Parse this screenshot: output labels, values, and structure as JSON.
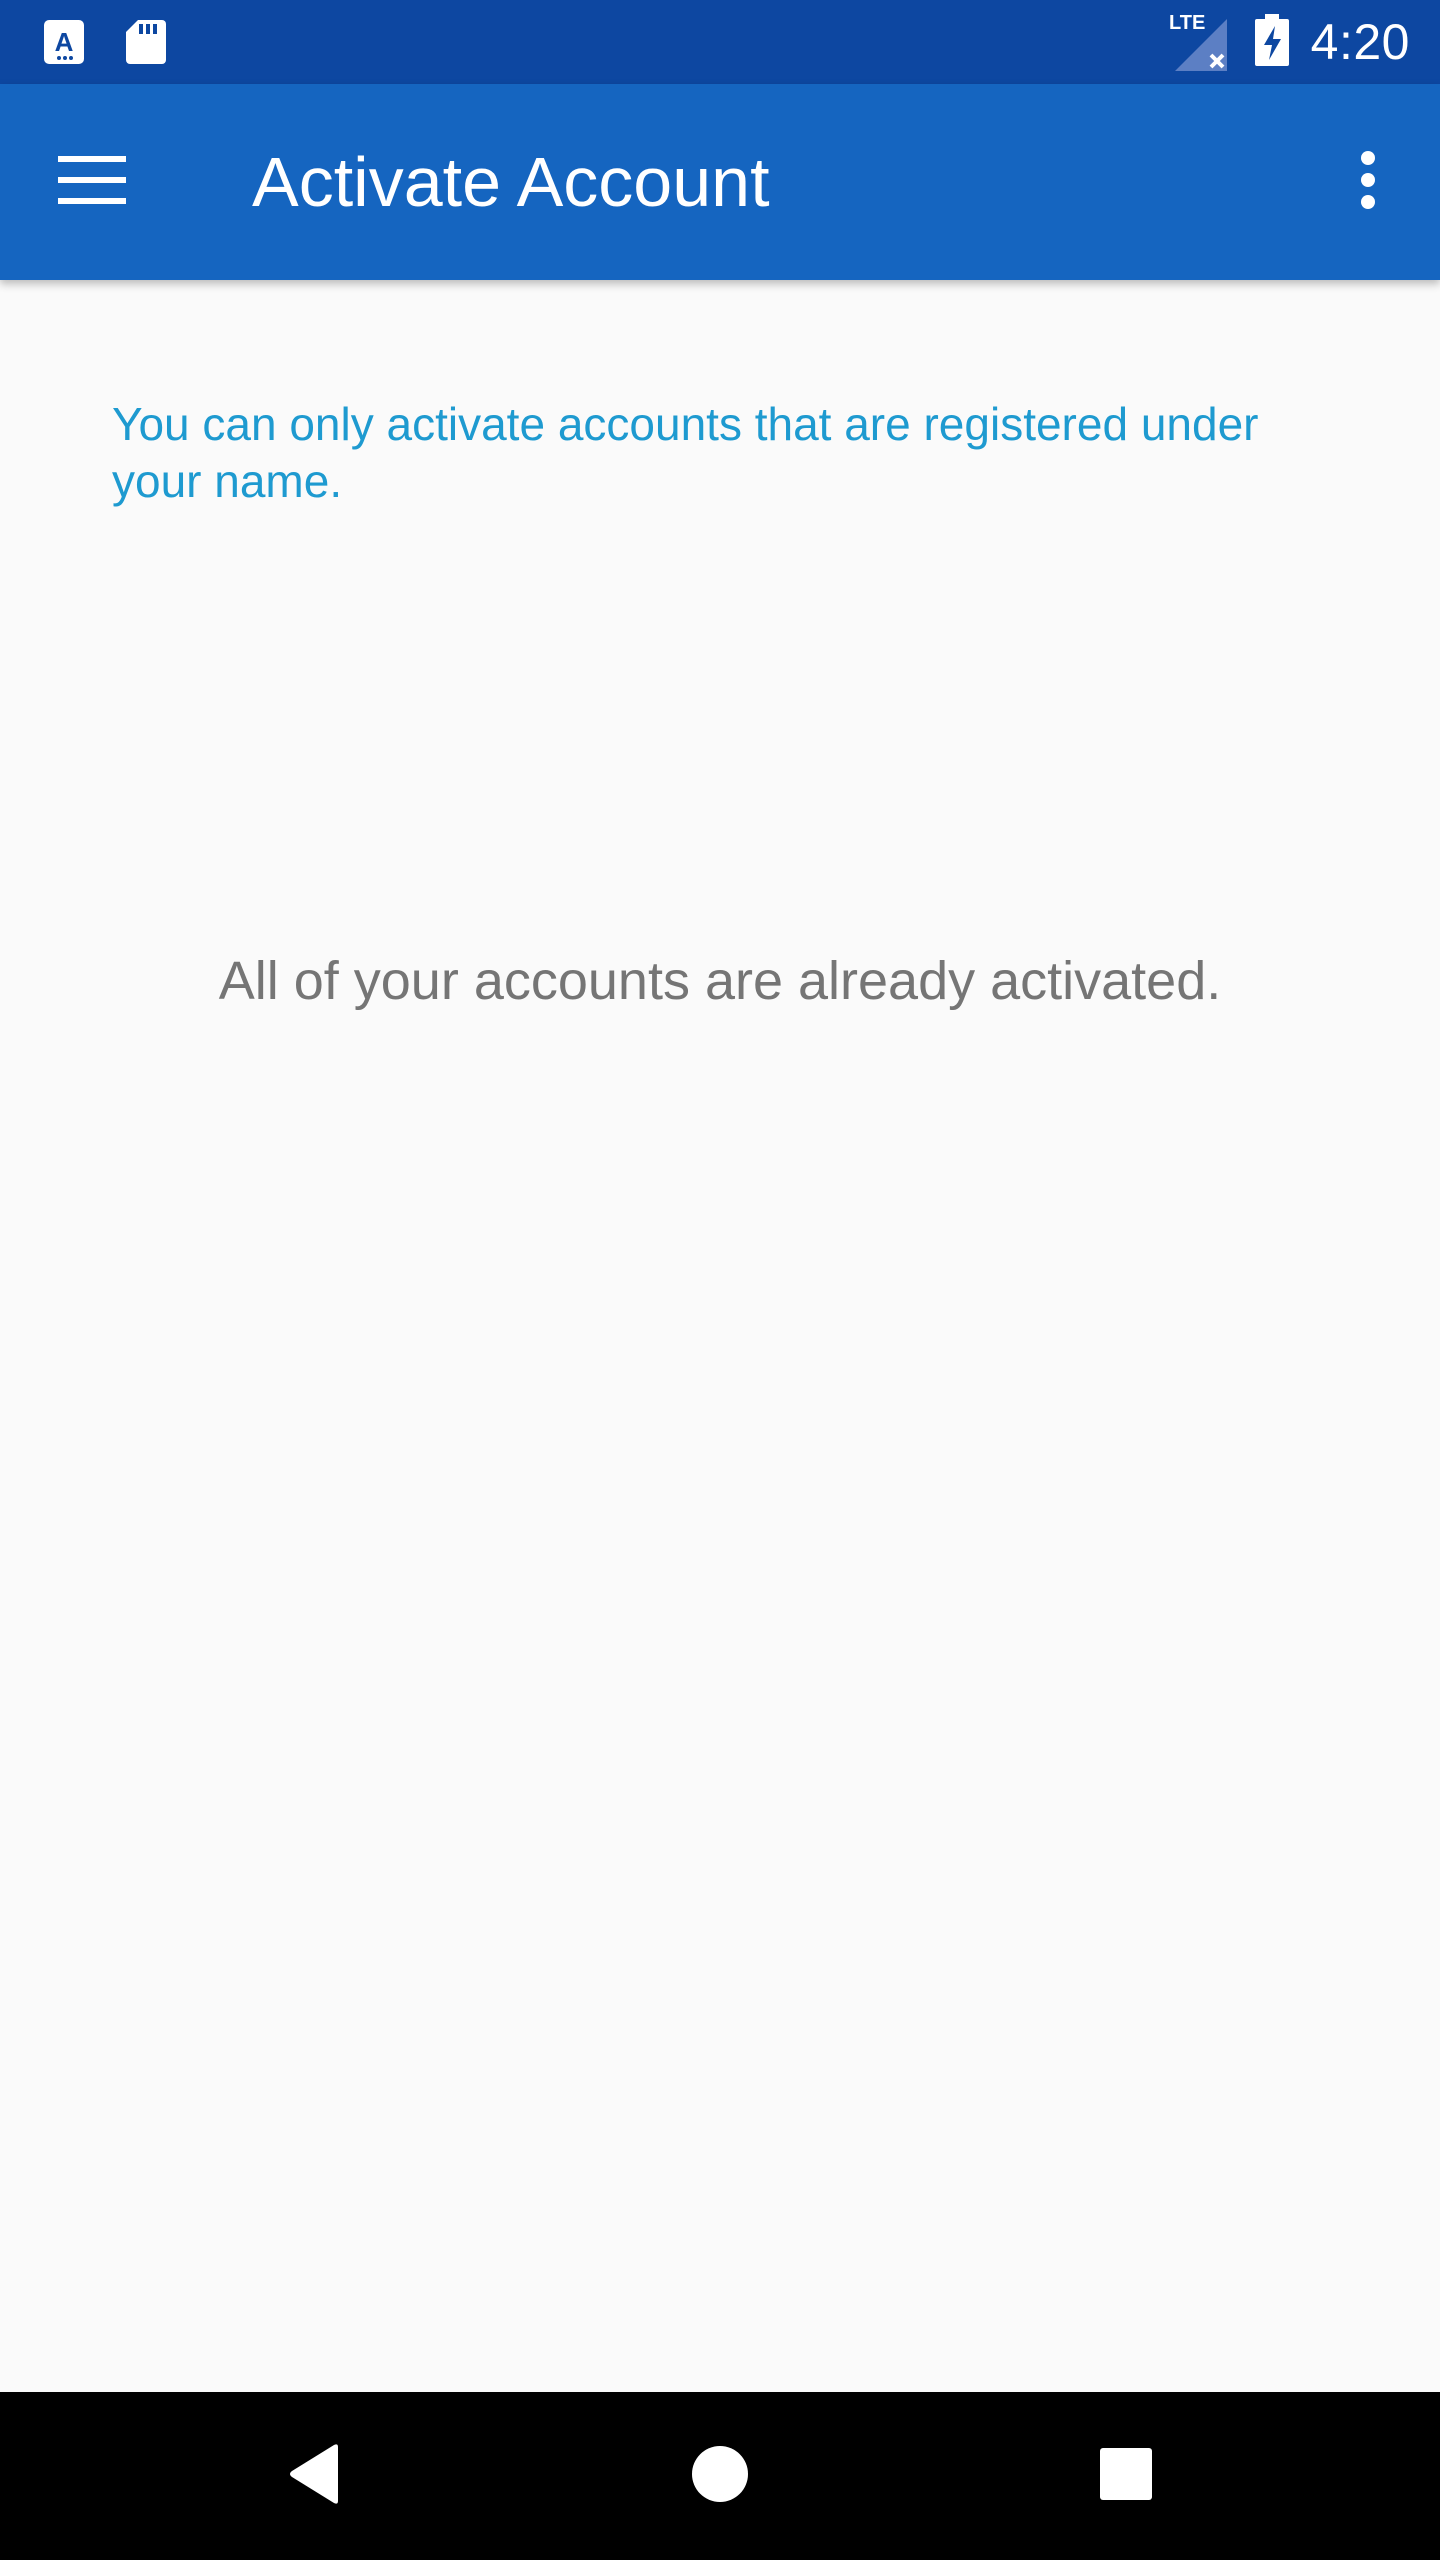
{
  "status_bar": {
    "time": "4:20",
    "network_label": "LTE",
    "icons": [
      "a-notification-icon",
      "sd-card-icon",
      "lte-signal-icon",
      "battery-charging-icon"
    ]
  },
  "app_bar": {
    "title": "Activate Account",
    "menu_icon": "hamburger-menu-icon",
    "overflow_icon": "more-vert-icon"
  },
  "content": {
    "info_text": "You can only activate accounts that are registered under your name.",
    "empty_message": "All of your accounts are already activated."
  },
  "nav_bar": {
    "icons": [
      "back-icon",
      "home-icon",
      "recents-icon"
    ]
  },
  "colors": {
    "status_bar": "#0d47a1",
    "app_bar": "#1565c0",
    "info_text": "#1e9ad0",
    "empty_text": "#757575",
    "background": "#fafafa"
  }
}
